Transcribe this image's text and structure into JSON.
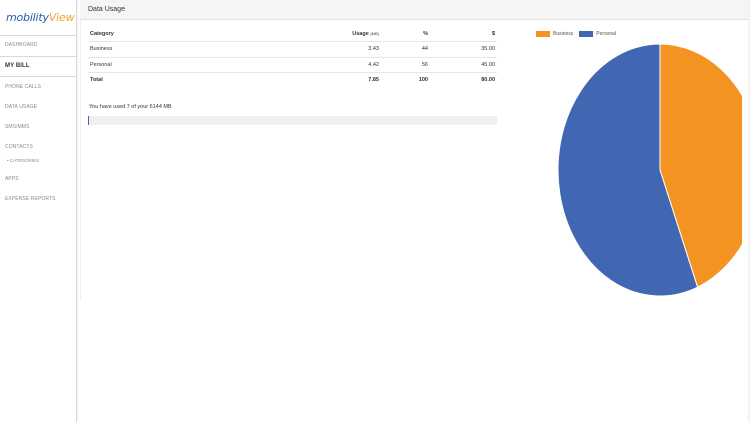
{
  "app": {
    "logo_part1": "mobility",
    "logo_part2": "View"
  },
  "sidebar": {
    "items": [
      {
        "label": "DASHBOARD"
      },
      {
        "label": "MY BILL"
      },
      {
        "label": "PHONE CALLS"
      },
      {
        "label": "DATA USAGE"
      },
      {
        "label": "SMS/MMS"
      },
      {
        "label": "CONTACTS"
      },
      {
        "label": "CATEGORIES"
      },
      {
        "label": "APPS"
      },
      {
        "label": "EXPENSE REPORTS"
      }
    ],
    "sub_bullet": "•"
  },
  "page": {
    "title": "Data Usage"
  },
  "table": {
    "headers": {
      "category": "Category",
      "usage": "Usage",
      "usage_unit": "(MB)",
      "percent": "%",
      "dollar": "$"
    },
    "rows": [
      {
        "category": "Business",
        "usage": "3.43",
        "percent": "44",
        "dollar": "35.00"
      },
      {
        "category": "Personal",
        "usage": "4.42",
        "percent": "56",
        "dollar": "45.00"
      }
    ],
    "total": {
      "category": "Total",
      "usage": "7.85",
      "percent": "100",
      "dollar": "80.00"
    }
  },
  "usage_summary": {
    "text": "You have used 7 of your 6144 MB",
    "fraction_used": 0.0011
  },
  "colors": {
    "business": "#f39422",
    "personal": "#4267b2",
    "accent": "#2a5aa8",
    "logo_accent": "#f0a030"
  },
  "chart_data": {
    "type": "pie",
    "categories": [
      "Business",
      "Personal"
    ],
    "values": [
      44,
      56
    ],
    "colors": [
      "#f39422",
      "#4267b2"
    ],
    "legend": "top"
  }
}
